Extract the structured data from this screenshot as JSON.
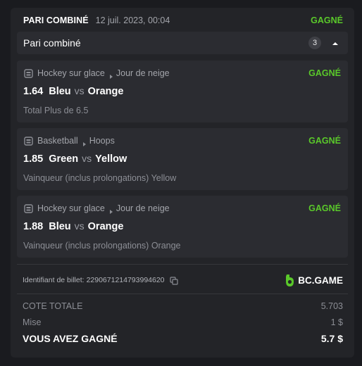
{
  "colors": {
    "success": "#5ac82a"
  },
  "header": {
    "title": "PARI COMBINÉ",
    "date": "12 juil. 2023, 00:04",
    "status": "GAGNÉ"
  },
  "section": {
    "title": "Pari combiné",
    "count": "3",
    "toggle_icon": "caret-up-icon"
  },
  "legs": [
    {
      "sport_icon": "gamepad-icon",
      "sport": "Hockey sur glace",
      "league": "Jour de neige",
      "status": "GAGNÉ",
      "odds": "1.64",
      "team_home": "Bleu",
      "vs": "vs",
      "team_away": "Orange",
      "market": "Total Plus de 6.5"
    },
    {
      "sport_icon": "gamepad-icon",
      "sport": "Basketball",
      "league": "Hoops",
      "status": "GAGNÉ",
      "odds": "1.85",
      "team_home": "Green",
      "vs": "vs",
      "team_away": "Yellow",
      "market": "Vainqueur (inclus prolongations) Yellow"
    },
    {
      "sport_icon": "gamepad-icon",
      "sport": "Hockey sur glace",
      "league": "Jour de neige",
      "status": "GAGNÉ",
      "odds": "1.88",
      "team_home": "Bleu",
      "vs": "vs",
      "team_away": "Orange",
      "market": "Vainqueur (inclus prolongations) Orange"
    }
  ],
  "ticket": {
    "label": "Identifiant de billet:",
    "id": "2290671214793994620",
    "copy_icon": "copy-icon"
  },
  "brand": {
    "name": "BC.GAME",
    "logo_icon": "bcgame-logo-icon"
  },
  "summary": {
    "total_odds_label": "COTE TOTALE",
    "total_odds_value": "5.703",
    "stake_label": "Mise",
    "stake_value": "1 $",
    "won_label": "VOUS AVEZ GAGNÉ",
    "won_value": "5.7 $"
  }
}
